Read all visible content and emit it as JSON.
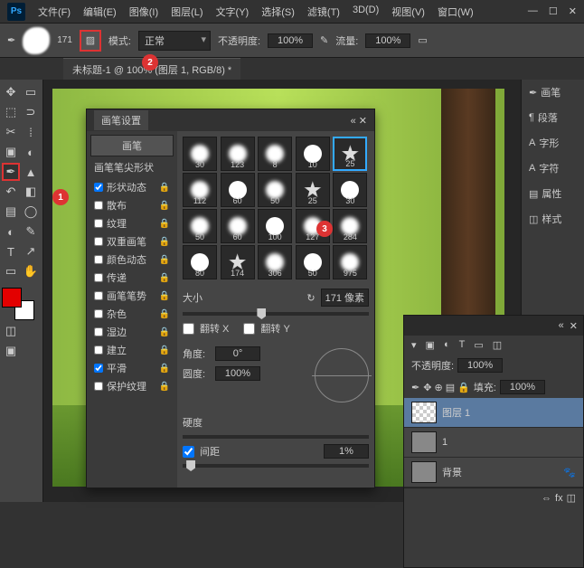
{
  "app": {
    "logo": "Ps"
  },
  "menu": [
    "文件(F)",
    "编辑(E)",
    "图像(I)",
    "图层(L)",
    "文字(Y)",
    "选择(S)",
    "滤镜(T)",
    "3D(D)",
    "视图(V)",
    "窗口(W)"
  ],
  "toolbar": {
    "brush_size": "171",
    "mode_label": "模式:",
    "mode_value": "正常",
    "opacity_label": "不透明度:",
    "opacity_value": "100%",
    "flow_label": "流量:",
    "flow_value": "100%"
  },
  "doc_tab": "未标题-1 @ 100% (图层 1, RGB/8) *",
  "brush_panel": {
    "title": "画笔设置",
    "brush_btn": "画笔",
    "tip_shape": "画笔笔尖形状",
    "options": [
      {
        "label": "形状动态",
        "checked": true
      },
      {
        "label": "散布",
        "checked": false
      },
      {
        "label": "纹理",
        "checked": false
      },
      {
        "label": "双重画笔",
        "checked": false
      },
      {
        "label": "颜色动态",
        "checked": false
      },
      {
        "label": "传递",
        "checked": false
      },
      {
        "label": "画笔笔势",
        "checked": false
      },
      {
        "label": "杂色",
        "checked": false
      },
      {
        "label": "湿边",
        "checked": false
      },
      {
        "label": "建立",
        "checked": false
      },
      {
        "label": "平滑",
        "checked": true
      },
      {
        "label": "保护纹理",
        "checked": false
      }
    ],
    "brushes": [
      30,
      123,
      8,
      10,
      25,
      112,
      60,
      50,
      25,
      30,
      50,
      60,
      100,
      127,
      284,
      80,
      174,
      306,
      50,
      975
    ],
    "selected_brush_index": 4,
    "size_label": "大小",
    "size_value": "171 像素",
    "flipx": "翻转 X",
    "flipy": "翻转 Y",
    "angle_label": "角度:",
    "angle_value": "0°",
    "round_label": "圆度:",
    "round_value": "100%",
    "hardness_label": "硬度",
    "spacing_label": "间距",
    "spacing_value": "1%"
  },
  "right_panel": [
    "画笔",
    "段落",
    "字形",
    "字符",
    "属性",
    "样式"
  ],
  "layers": {
    "opacity_label": "不透明度:",
    "opacity_value": "100%",
    "lock_label": "锁定:",
    "fill_label": "填充:",
    "fill_value": "100%",
    "items": [
      {
        "name": "图层 1"
      },
      {
        "name": "1"
      },
      {
        "name": "背景"
      }
    ]
  },
  "annotations": {
    "a1": "1",
    "a2": "2",
    "a3": "3"
  }
}
